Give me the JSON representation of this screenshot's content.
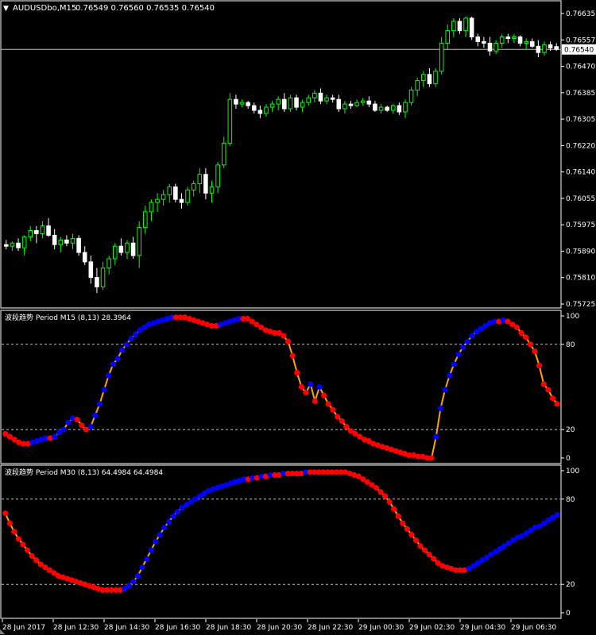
{
  "main_chart": {
    "title": "AUDUSDbo,M15",
    "ohlc_values": "0.76549 0.76560 0.76535 0.76540",
    "last_price": "0.76540",
    "price_ticks": [
      "0.76635",
      "0.76557",
      "0.76470",
      "0.76385",
      "0.76305",
      "0.76220",
      "0.76140",
      "0.76055",
      "0.75975",
      "0.75890",
      "0.75810",
      "0.75725"
    ],
    "current_price": 0.7654,
    "ylim": [
      0.75725,
      0.76655
    ],
    "bull_color": "#00ff00",
    "bear_color": "#ffffff"
  },
  "indicator1": {
    "title": "波段趋势 Period M15 (8,13) 28.3964",
    "ticks": [
      "100",
      "80",
      "20",
      "0"
    ],
    "levels": [
      80,
      20
    ],
    "ylim": [
      0,
      100
    ],
    "line_color": "#ffa500",
    "rising_color": "#0000ff",
    "falling_color": "#ff0000"
  },
  "indicator2": {
    "title": "波段趋势 Period M30 (8,13) 64.4984 64.4984",
    "ticks": [
      "100",
      "80",
      "20",
      "0"
    ],
    "levels": [
      80,
      20
    ],
    "ylim": [
      0,
      100
    ],
    "line_color": "#ffa500",
    "rising_color": "#0000ff",
    "falling_color": "#ff0000"
  },
  "time_axis": {
    "labels": [
      "28 Jun 2017",
      "28 Jun 12:30",
      "28 Jun 14:30",
      "28 Jun 16:30",
      "28 Jun 18:30",
      "28 Jun 20:30",
      "28 Jun 22:30",
      "29 Jun 00:30",
      "29 Jun 02:30",
      "29 Jun 04:30",
      "29 Jun 06:30"
    ]
  },
  "chart_data": [
    {
      "type": "candlestick",
      "title": "AUDUSDbo,M15",
      "x_start": "28 Jun 2017",
      "x_step_minutes": 15,
      "ohlc": [
        {
          "o": 0.75915,
          "h": 0.7593,
          "l": 0.759,
          "c": 0.7591
        },
        {
          "o": 0.7591,
          "h": 0.75925,
          "l": 0.75895,
          "c": 0.7592
        },
        {
          "o": 0.7592,
          "h": 0.75935,
          "l": 0.75895,
          "c": 0.75905
        },
        {
          "o": 0.75905,
          "h": 0.75945,
          "l": 0.7588,
          "c": 0.7594
        },
        {
          "o": 0.7594,
          "h": 0.75975,
          "l": 0.75925,
          "c": 0.7596
        },
        {
          "o": 0.7596,
          "h": 0.75975,
          "l": 0.7592,
          "c": 0.7595
        },
        {
          "o": 0.7595,
          "h": 0.7599,
          "l": 0.75935,
          "c": 0.75975
        },
        {
          "o": 0.75975,
          "h": 0.76,
          "l": 0.7594,
          "c": 0.75945
        },
        {
          "o": 0.75945,
          "h": 0.75965,
          "l": 0.759,
          "c": 0.75915
        },
        {
          "o": 0.75915,
          "h": 0.7594,
          "l": 0.7589,
          "c": 0.7593
        },
        {
          "o": 0.7593,
          "h": 0.75945,
          "l": 0.7591,
          "c": 0.7592
        },
        {
          "o": 0.7592,
          "h": 0.7595,
          "l": 0.759,
          "c": 0.75935
        },
        {
          "o": 0.75935,
          "h": 0.75945,
          "l": 0.7588,
          "c": 0.7589
        },
        {
          "o": 0.7589,
          "h": 0.7591,
          "l": 0.7585,
          "c": 0.7586
        },
        {
          "o": 0.7586,
          "h": 0.7588,
          "l": 0.7579,
          "c": 0.7581
        },
        {
          "o": 0.7581,
          "h": 0.7584,
          "l": 0.7576,
          "c": 0.7578
        },
        {
          "o": 0.7578,
          "h": 0.7586,
          "l": 0.7577,
          "c": 0.7584
        },
        {
          "o": 0.7584,
          "h": 0.7588,
          "l": 0.7582,
          "c": 0.7587
        },
        {
          "o": 0.7587,
          "h": 0.7592,
          "l": 0.7585,
          "c": 0.7591
        },
        {
          "o": 0.7591,
          "h": 0.75935,
          "l": 0.7588,
          "c": 0.7589
        },
        {
          "o": 0.7589,
          "h": 0.7593,
          "l": 0.7587,
          "c": 0.7592
        },
        {
          "o": 0.7592,
          "h": 0.7594,
          "l": 0.7587,
          "c": 0.7588
        },
        {
          "o": 0.7588,
          "h": 0.7599,
          "l": 0.7584,
          "c": 0.7597
        },
        {
          "o": 0.7597,
          "h": 0.7604,
          "l": 0.7595,
          "c": 0.7602
        },
        {
          "o": 0.7602,
          "h": 0.7606,
          "l": 0.7599,
          "c": 0.7605
        },
        {
          "o": 0.7605,
          "h": 0.7608,
          "l": 0.7602,
          "c": 0.7606
        },
        {
          "o": 0.7606,
          "h": 0.7609,
          "l": 0.7604,
          "c": 0.76075
        },
        {
          "o": 0.76075,
          "h": 0.7611,
          "l": 0.7605,
          "c": 0.761
        },
        {
          "o": 0.761,
          "h": 0.7611,
          "l": 0.7605,
          "c": 0.7606
        },
        {
          "o": 0.7606,
          "h": 0.7608,
          "l": 0.7603,
          "c": 0.7605
        },
        {
          "o": 0.7605,
          "h": 0.761,
          "l": 0.7604,
          "c": 0.7609
        },
        {
          "o": 0.7609,
          "h": 0.7612,
          "l": 0.7607,
          "c": 0.7611
        },
        {
          "o": 0.7611,
          "h": 0.7616,
          "l": 0.7608,
          "c": 0.7614
        },
        {
          "o": 0.7614,
          "h": 0.7616,
          "l": 0.7606,
          "c": 0.7608
        },
        {
          "o": 0.7608,
          "h": 0.7612,
          "l": 0.7605,
          "c": 0.761
        },
        {
          "o": 0.761,
          "h": 0.7618,
          "l": 0.7608,
          "c": 0.7617
        },
        {
          "o": 0.7617,
          "h": 0.7626,
          "l": 0.7616,
          "c": 0.7624
        },
        {
          "o": 0.7624,
          "h": 0.764,
          "l": 0.7623,
          "c": 0.7638
        },
        {
          "o": 0.7638,
          "h": 0.76395,
          "l": 0.7635,
          "c": 0.76365
        },
        {
          "o": 0.76365,
          "h": 0.7638,
          "l": 0.76355,
          "c": 0.7637
        },
        {
          "o": 0.7637,
          "h": 0.76375,
          "l": 0.7635,
          "c": 0.7636
        },
        {
          "o": 0.7636,
          "h": 0.7637,
          "l": 0.76335,
          "c": 0.76345
        },
        {
          "o": 0.76345,
          "h": 0.7636,
          "l": 0.7632,
          "c": 0.76335
        },
        {
          "o": 0.76335,
          "h": 0.76365,
          "l": 0.76325,
          "c": 0.76355
        },
        {
          "o": 0.76355,
          "h": 0.76375,
          "l": 0.7634,
          "c": 0.76365
        },
        {
          "o": 0.76365,
          "h": 0.7639,
          "l": 0.76345,
          "c": 0.7638
        },
        {
          "o": 0.7638,
          "h": 0.764,
          "l": 0.7634,
          "c": 0.7635
        },
        {
          "o": 0.7635,
          "h": 0.76395,
          "l": 0.7634,
          "c": 0.76385
        },
        {
          "o": 0.76385,
          "h": 0.76395,
          "l": 0.76345,
          "c": 0.76355
        },
        {
          "o": 0.76355,
          "h": 0.7638,
          "l": 0.7634,
          "c": 0.7637
        },
        {
          "o": 0.7637,
          "h": 0.76395,
          "l": 0.7636,
          "c": 0.76385
        },
        {
          "o": 0.76385,
          "h": 0.7641,
          "l": 0.7637,
          "c": 0.764
        },
        {
          "o": 0.764,
          "h": 0.76415,
          "l": 0.76365,
          "c": 0.76375
        },
        {
          "o": 0.76375,
          "h": 0.76395,
          "l": 0.76365,
          "c": 0.76385
        },
        {
          "o": 0.76385,
          "h": 0.76395,
          "l": 0.7637,
          "c": 0.7638
        },
        {
          "o": 0.7638,
          "h": 0.76395,
          "l": 0.7634,
          "c": 0.7635
        },
        {
          "o": 0.7635,
          "h": 0.76375,
          "l": 0.76335,
          "c": 0.76365
        },
        {
          "o": 0.76365,
          "h": 0.76375,
          "l": 0.7635,
          "c": 0.7636
        },
        {
          "o": 0.7636,
          "h": 0.7638,
          "l": 0.76355,
          "c": 0.7637
        },
        {
          "o": 0.7637,
          "h": 0.76385,
          "l": 0.7636,
          "c": 0.76375
        },
        {
          "o": 0.76375,
          "h": 0.7639,
          "l": 0.76355,
          "c": 0.76365
        },
        {
          "o": 0.76365,
          "h": 0.76375,
          "l": 0.7634,
          "c": 0.76345
        },
        {
          "o": 0.76345,
          "h": 0.76365,
          "l": 0.76335,
          "c": 0.76355
        },
        {
          "o": 0.76355,
          "h": 0.7636,
          "l": 0.7634,
          "c": 0.76345
        },
        {
          "o": 0.76345,
          "h": 0.76365,
          "l": 0.76335,
          "c": 0.7636
        },
        {
          "o": 0.7636,
          "h": 0.7637,
          "l": 0.7633,
          "c": 0.7634
        },
        {
          "o": 0.7634,
          "h": 0.7638,
          "l": 0.7632,
          "c": 0.7637
        },
        {
          "o": 0.7637,
          "h": 0.7642,
          "l": 0.7636,
          "c": 0.7641
        },
        {
          "o": 0.7641,
          "h": 0.7645,
          "l": 0.7639,
          "c": 0.7644
        },
        {
          "o": 0.7644,
          "h": 0.7647,
          "l": 0.7642,
          "c": 0.7646
        },
        {
          "o": 0.7646,
          "h": 0.7648,
          "l": 0.7642,
          "c": 0.7643
        },
        {
          "o": 0.7643,
          "h": 0.7648,
          "l": 0.7642,
          "c": 0.7647
        },
        {
          "o": 0.7647,
          "h": 0.7658,
          "l": 0.7646,
          "c": 0.7656
        },
        {
          "o": 0.7656,
          "h": 0.7662,
          "l": 0.7654,
          "c": 0.766
        },
        {
          "o": 0.766,
          "h": 0.7664,
          "l": 0.7658,
          "c": 0.7663
        },
        {
          "o": 0.7663,
          "h": 0.7664,
          "l": 0.7659,
          "c": 0.766
        },
        {
          "o": 0.766,
          "h": 0.76645,
          "l": 0.7658,
          "c": 0.7664
        },
        {
          "o": 0.7664,
          "h": 0.76645,
          "l": 0.7657,
          "c": 0.7658
        },
        {
          "o": 0.7658,
          "h": 0.7659,
          "l": 0.7655,
          "c": 0.76565
        },
        {
          "o": 0.76565,
          "h": 0.7658,
          "l": 0.76545,
          "c": 0.7656
        },
        {
          "o": 0.7656,
          "h": 0.7658,
          "l": 0.7652,
          "c": 0.76535
        },
        {
          "o": 0.76535,
          "h": 0.7657,
          "l": 0.76525,
          "c": 0.7656
        },
        {
          "o": 0.7656,
          "h": 0.7659,
          "l": 0.76545,
          "c": 0.7658
        },
        {
          "o": 0.7658,
          "h": 0.7659,
          "l": 0.7656,
          "c": 0.76575
        },
        {
          "o": 0.76575,
          "h": 0.7659,
          "l": 0.7656,
          "c": 0.7658
        },
        {
          "o": 0.7658,
          "h": 0.76585,
          "l": 0.7655,
          "c": 0.7656
        },
        {
          "o": 0.7656,
          "h": 0.76575,
          "l": 0.7654,
          "c": 0.76565
        },
        {
          "o": 0.76565,
          "h": 0.76575,
          "l": 0.76545,
          "c": 0.7655
        },
        {
          "o": 0.7655,
          "h": 0.7657,
          "l": 0.76515,
          "c": 0.7653
        },
        {
          "o": 0.7653,
          "h": 0.76565,
          "l": 0.7652,
          "c": 0.76555
        },
        {
          "o": 0.76555,
          "h": 0.76565,
          "l": 0.76535,
          "c": 0.76545
        },
        {
          "o": 0.76549,
          "h": 0.7656,
          "l": 0.76535,
          "c": 0.7654
        }
      ]
    },
    {
      "type": "line",
      "title": "波段趋势 Period M15 (8,13) 28.3964",
      "ylim": [
        0,
        100
      ],
      "series": [
        {
          "values": [
            17,
            15,
            13,
            11,
            10,
            10,
            11,
            12,
            13,
            14,
            14,
            15,
            18,
            20,
            25,
            28,
            27,
            23,
            20,
            22,
            30,
            38,
            48,
            58,
            66,
            70,
            76,
            80,
            84,
            87,
            90,
            92,
            94,
            95,
            96,
            97,
            98,
            99,
            99,
            99,
            99,
            98,
            97,
            96,
            95,
            94,
            93,
            93,
            94,
            95,
            96,
            97,
            98,
            98,
            98,
            96,
            94,
            92,
            90,
            89,
            88,
            88,
            86,
            82,
            72,
            60,
            50,
            46,
            52,
            40,
            50,
            44,
            38,
            34,
            29,
            26,
            22,
            19,
            17,
            15,
            13,
            12,
            10,
            9,
            8,
            7,
            6,
            5,
            4,
            3,
            2,
            2,
            1,
            1,
            0,
            0,
            15,
            35,
            48,
            58,
            66,
            73,
            78,
            82,
            86,
            89,
            91,
            93,
            95,
            96,
            96,
            97,
            96,
            94,
            92,
            88,
            85,
            80,
            75,
            65,
            52,
            48,
            42,
            38
          ]
        }
      ]
    },
    {
      "type": "line",
      "title": "波段趋势 Period M30 (8,13) 64.4984 64.4984",
      "ylim": [
        0,
        100
      ],
      "series": [
        {
          "values": [
            70,
            63,
            57,
            52,
            48,
            44,
            40,
            37,
            34,
            32,
            30,
            28,
            26,
            25,
            24,
            23,
            22,
            21,
            20,
            19,
            18,
            17,
            16,
            16,
            16,
            16,
            16,
            17,
            19,
            22,
            26,
            32,
            38,
            44,
            50,
            55,
            60,
            64,
            68,
            71,
            74,
            76,
            78,
            80,
            82,
            84,
            86,
            87,
            88,
            89,
            90,
            91,
            92,
            93,
            94,
            94,
            95,
            95,
            96,
            96,
            97,
            97,
            97,
            98,
            98,
            98,
            98,
            98,
            99,
            99,
            99,
            99,
            99,
            99,
            99,
            99,
            99,
            99,
            98,
            97,
            96,
            94,
            92,
            90,
            88,
            85,
            82,
            78,
            73,
            68,
            63,
            59,
            55,
            51,
            47,
            44,
            41,
            38,
            35,
            33,
            32,
            31,
            30,
            30,
            30,
            31,
            33,
            35,
            37,
            39,
            41,
            43,
            45,
            47,
            49,
            51,
            53,
            54,
            56,
            58,
            60,
            61,
            63,
            65,
            67,
            69
          ]
        }
      ]
    }
  ]
}
